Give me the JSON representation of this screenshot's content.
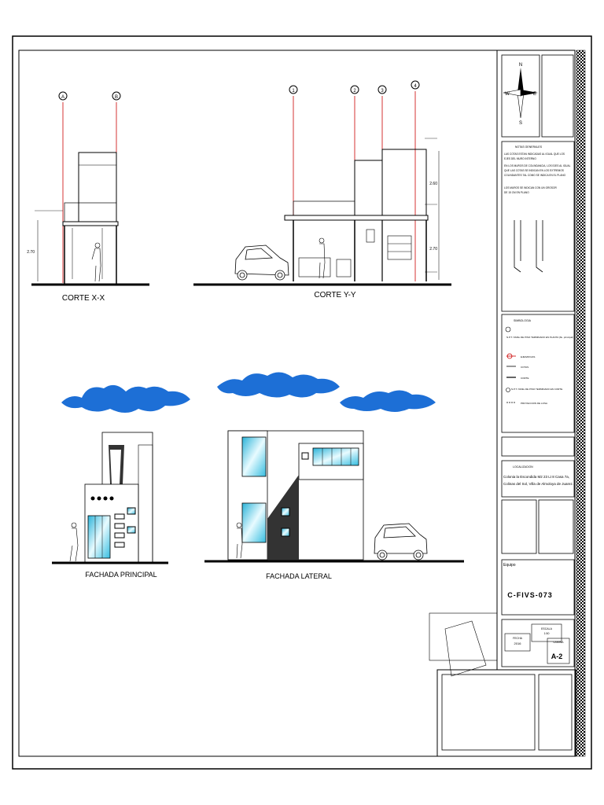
{
  "drawing": {
    "sections": {
      "corte_xx": "CORTE X-X",
      "corte_yy": "CORTE Y-Y",
      "fachada_principal": "FACHADA PRINCIPAL",
      "fachada_lateral": "FACHADA LATERAL"
    },
    "axes_xx": [
      "A",
      "B"
    ],
    "axes_yy": [
      "1",
      "2",
      "3",
      "4"
    ],
    "dims": {
      "h1": "2.70",
      "h2": "2.60",
      "h3": "2.70"
    }
  },
  "title_block": {
    "compass": {
      "n": "N",
      "s": "S",
      "e": "E",
      "w": "W"
    },
    "notes_title": "NOTAS GENERALES",
    "notes": [
      "LAS COTAS ESTAN INDICADAS AL IGUAL QUE LOS",
      "EJES DEL MURO INTERNO",
      "EN LOS MUROS DE COLINDANCIA, LOS EJES AL IGUAL",
      "QUE LAS COTAS SE INDICAN EN LOS EXTREMOS",
      "COLINDANTES TAL COMO SE INDICA EN EL PLANO",
      "LOS MUROS SE INDICAN CON UN GROSOR",
      "DE 15 CM EN PLANO"
    ],
    "symbology_title": "SIMBOLOGIA",
    "symbology": [
      "N.P.T. NIVEL DE PISO TERMINADO EN PLANTA (flu. principal)",
      "EJES/ROJAS",
      "COTAS",
      "CORTE",
      "N.P.T. NIVEL DE PISO TERMINADO EN CORTE",
      "PROYECCION DE LOSA"
    ],
    "location_title": "LOCALIZACION",
    "location": [
      "Colonia la Escondida M2 23 Lt 8 Casa 7a,",
      "Colinas del Sol, Villa de Almoloya de Juarez."
    ],
    "team_label": "Equipo",
    "team_code": "C-FIVS-073",
    "escala_label": "ESCALA",
    "escala_value": "1:50",
    "fecha_label": "FECHA",
    "fecha_value": "2016",
    "sheet_label": "LAMINA",
    "sheet_value": "A-2"
  }
}
